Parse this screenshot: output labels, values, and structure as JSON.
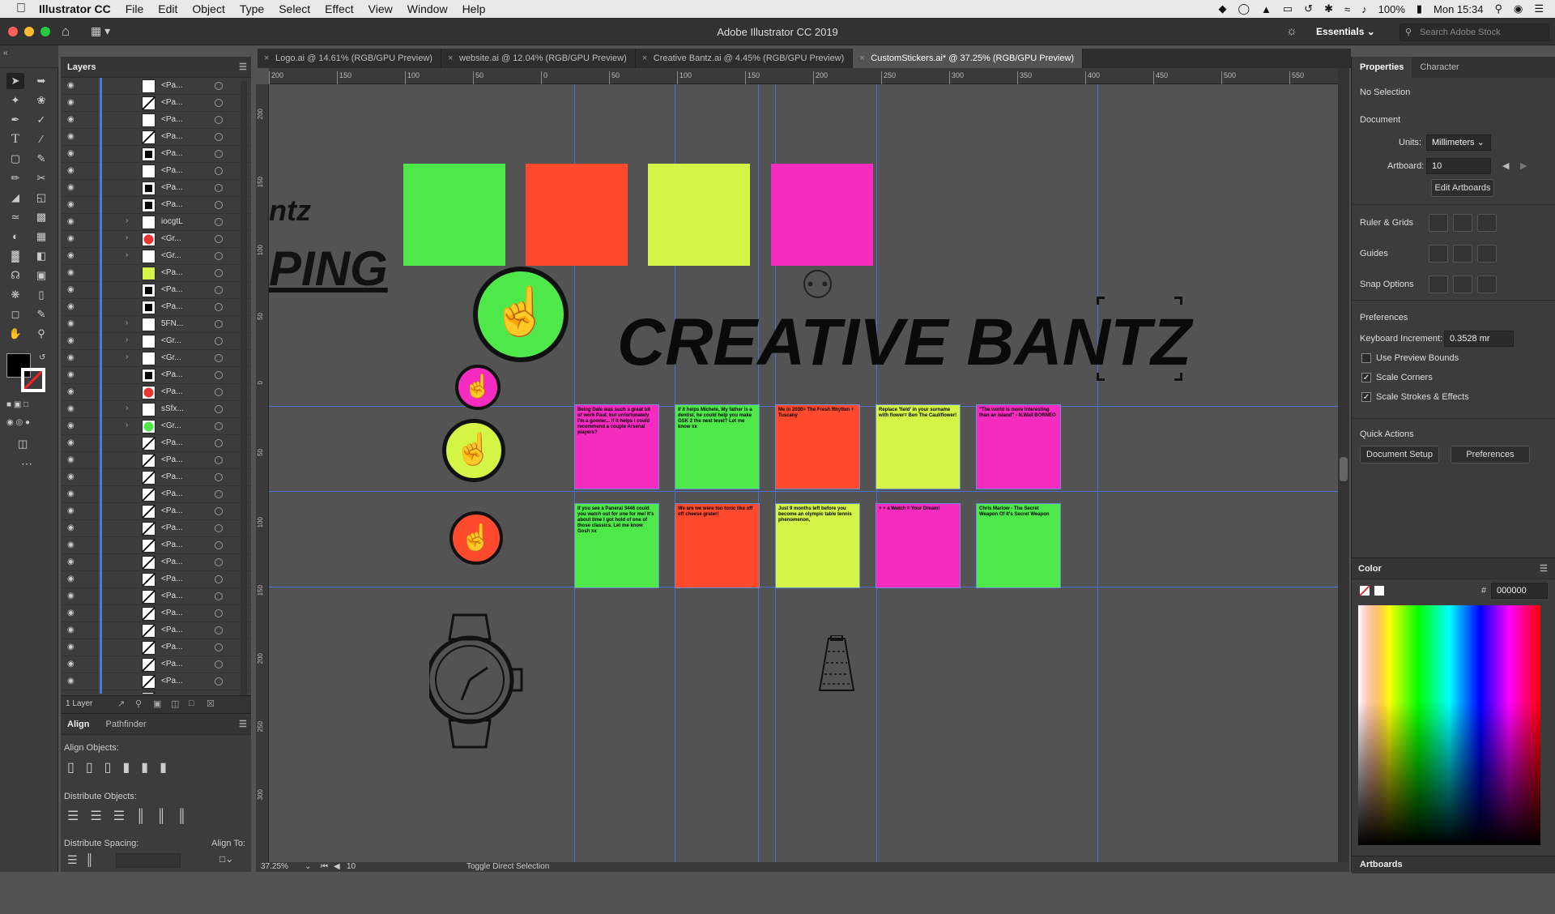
{
  "macmenu": {
    "apple": "",
    "app": "Illustrator CC",
    "items": [
      "File",
      "Edit",
      "Object",
      "Type",
      "Select",
      "Effect",
      "View",
      "Window",
      "Help"
    ],
    "battery": "100%",
    "clock": "Mon 15:34"
  },
  "titlebar": {
    "title": "Adobe Illustrator CC 2019",
    "workspace": "Essentials",
    "search_placeholder": "Search Adobe Stock"
  },
  "tabs": [
    {
      "label": "Logo.ai @ 14.61% (RGB/GPU Preview)"
    },
    {
      "label": "website.ai @ 12.04% (RGB/GPU Preview)"
    },
    {
      "label": "Creative Bantz.ai @ 4.45% (RGB/GPU Preview)"
    },
    {
      "label": "CustomStickers.ai* @ 37.25% (RGB/GPU Preview)"
    }
  ],
  "hruler_ticks": [
    "200",
    "150",
    "100",
    "50",
    "0",
    "50",
    "100",
    "150",
    "200",
    "250",
    "300",
    "350",
    "400",
    "450",
    "500",
    "550"
  ],
  "vruler_ticks": [
    "200",
    "150",
    "100",
    "50",
    "0",
    "50",
    "100",
    "150",
    "200",
    "250",
    "300"
  ],
  "layers": {
    "title": "Layers",
    "rows": [
      {
        "name": "<Pa...",
        "twirl": "",
        "thumb": "white"
      },
      {
        "name": "<Pa...",
        "twirl": "",
        "thumb": "diag"
      },
      {
        "name": "<Pa...",
        "twirl": "",
        "thumb": "white"
      },
      {
        "name": "<Pa...",
        "twirl": "",
        "thumb": "diag"
      },
      {
        "name": "<Pa...",
        "twirl": "",
        "thumb": "black"
      },
      {
        "name": "<Pa...",
        "twirl": "",
        "thumb": "white"
      },
      {
        "name": "<Pa...",
        "twirl": "",
        "thumb": "black"
      },
      {
        "name": "<Pa...",
        "twirl": "",
        "thumb": "black"
      },
      {
        "name": "iocgtL",
        "twirl": ">",
        "thumb": "white"
      },
      {
        "name": "<Gr...",
        "twirl": ">",
        "thumb": "red"
      },
      {
        "name": "<Gr...",
        "twirl": ">",
        "thumb": "white"
      },
      {
        "name": "<Pa...",
        "twirl": "",
        "thumb": "lime"
      },
      {
        "name": "<Pa...",
        "twirl": "",
        "thumb": "black"
      },
      {
        "name": "<Pa...",
        "twirl": "",
        "thumb": "black"
      },
      {
        "name": "5FN...",
        "twirl": ">",
        "thumb": "white"
      },
      {
        "name": "<Gr...",
        "twirl": ">",
        "thumb": "white"
      },
      {
        "name": "<Gr...",
        "twirl": ">",
        "thumb": "white"
      },
      {
        "name": "<Pa...",
        "twirl": "",
        "thumb": "black"
      },
      {
        "name": "<Pa...",
        "twirl": "",
        "thumb": "red"
      },
      {
        "name": "sSfx...",
        "twirl": ">",
        "thumb": "white"
      },
      {
        "name": "<Gr...",
        "twirl": ">",
        "thumb": "green"
      },
      {
        "name": "<Pa...",
        "twirl": "",
        "thumb": "diag"
      },
      {
        "name": "<Pa...",
        "twirl": "",
        "thumb": "diag"
      },
      {
        "name": "<Pa...",
        "twirl": "",
        "thumb": "diag"
      },
      {
        "name": "<Pa...",
        "twirl": "",
        "thumb": "diag"
      },
      {
        "name": "<Pa...",
        "twirl": "",
        "thumb": "diag"
      },
      {
        "name": "<Pa...",
        "twirl": "",
        "thumb": "diag"
      },
      {
        "name": "<Pa...",
        "twirl": "",
        "thumb": "diag"
      },
      {
        "name": "<Pa...",
        "twirl": "",
        "thumb": "diag"
      },
      {
        "name": "<Pa...",
        "twirl": "",
        "thumb": "diag"
      },
      {
        "name": "<Pa...",
        "twirl": "",
        "thumb": "diag"
      },
      {
        "name": "<Pa...",
        "twirl": "",
        "thumb": "diag"
      },
      {
        "name": "<Pa...",
        "twirl": "",
        "thumb": "diag"
      },
      {
        "name": "<Pa...",
        "twirl": "",
        "thumb": "diag"
      },
      {
        "name": "<Pa...",
        "twirl": "",
        "thumb": "diag"
      },
      {
        "name": "<Pa...",
        "twirl": "",
        "thumb": "diag"
      },
      {
        "name": "<Pa...",
        "twirl": "",
        "thumb": "diag"
      }
    ],
    "footer": "1 Layer"
  },
  "align": {
    "tabs": [
      "Align",
      "Pathfinder"
    ],
    "align_objects": "Align Objects:",
    "distribute_objects": "Distribute Objects:",
    "distribute_spacing": "Distribute Spacing:",
    "align_to": "Align To:"
  },
  "canvas": {
    "partial_title_top": "ntz",
    "partial_title_bottom": "PING",
    "big_title": "CREATIVE BANTZ",
    "swatches": [
      "#4fe84a",
      "#ff4a2e",
      "#d4f446",
      "#f62bbf"
    ],
    "stickers": [
      {
        "color": "#f62bbf",
        "text": "Being Dale was such a great bit of work Paul, but unfortunately I'm a gooner... If it helps I could recommend a couple Arsenal players?"
      },
      {
        "color": "#4fe84a",
        "text": "If it helps Michele, My father is a dentist, he could help you make GSK 2 the next level? Let me know xx"
      },
      {
        "color": "#ff4a2e",
        "text": "Me in 2030= The Fresh Rhythm + Tuscany"
      },
      {
        "color": "#d4f446",
        "text": "Replace 'field' in your surname with flower= Ben The Cauliflower!"
      },
      {
        "color": "#f62bbf",
        "text": "\"The world is more interesting than an island\" - N.Wall BORNEO"
      },
      {
        "color": "#4fe84a",
        "text": "If you see a Panerai 3446 could you watch out for one for me! It's about time I got hold of one of those classics. Let me know Gosh xx"
      },
      {
        "color": "#ff4a2e",
        "text": "We are we were too toxic like off off cheese grater!"
      },
      {
        "color": "#d4f446",
        "text": "Just 9 months left before you become an olympic table tennis phenomenon,"
      },
      {
        "color": "#f62bbf",
        "text": "+ + a Watch = Your Dream!"
      },
      {
        "color": "#4fe84a",
        "text": "Chris Marlow - The Secret Weapon Of It's Secret Weapon"
      }
    ]
  },
  "properties": {
    "tabs": [
      "Properties",
      "Character"
    ],
    "selection": "No Selection",
    "document": "Document",
    "units_label": "Units:",
    "units_value": "Millimeters",
    "artboard_label": "Artboard:",
    "artboard_value": "10",
    "edit_artboards": "Edit Artboards",
    "ruler_grids": "Ruler & Grids",
    "guides": "Guides",
    "snap_options": "Snap Options",
    "preferences": "Preferences",
    "keyboard_increment_label": "Keyboard Increment:",
    "keyboard_increment_value": "0.3528 mr",
    "use_preview_bounds": "Use Preview Bounds",
    "scale_corners": "Scale Corners",
    "scale_strokes": "Scale Strokes & Effects",
    "quick_actions": "Quick Actions",
    "document_setup": "Document Setup",
    "preferences_btn": "Preferences"
  },
  "color_panel": {
    "title": "Color",
    "hex_label": "#",
    "hex_value": "000000"
  },
  "artboards_panel": {
    "title": "Artboards"
  },
  "status": {
    "zoom": "37.25%",
    "artboard": "10",
    "mode": "Toggle Direct Selection"
  }
}
